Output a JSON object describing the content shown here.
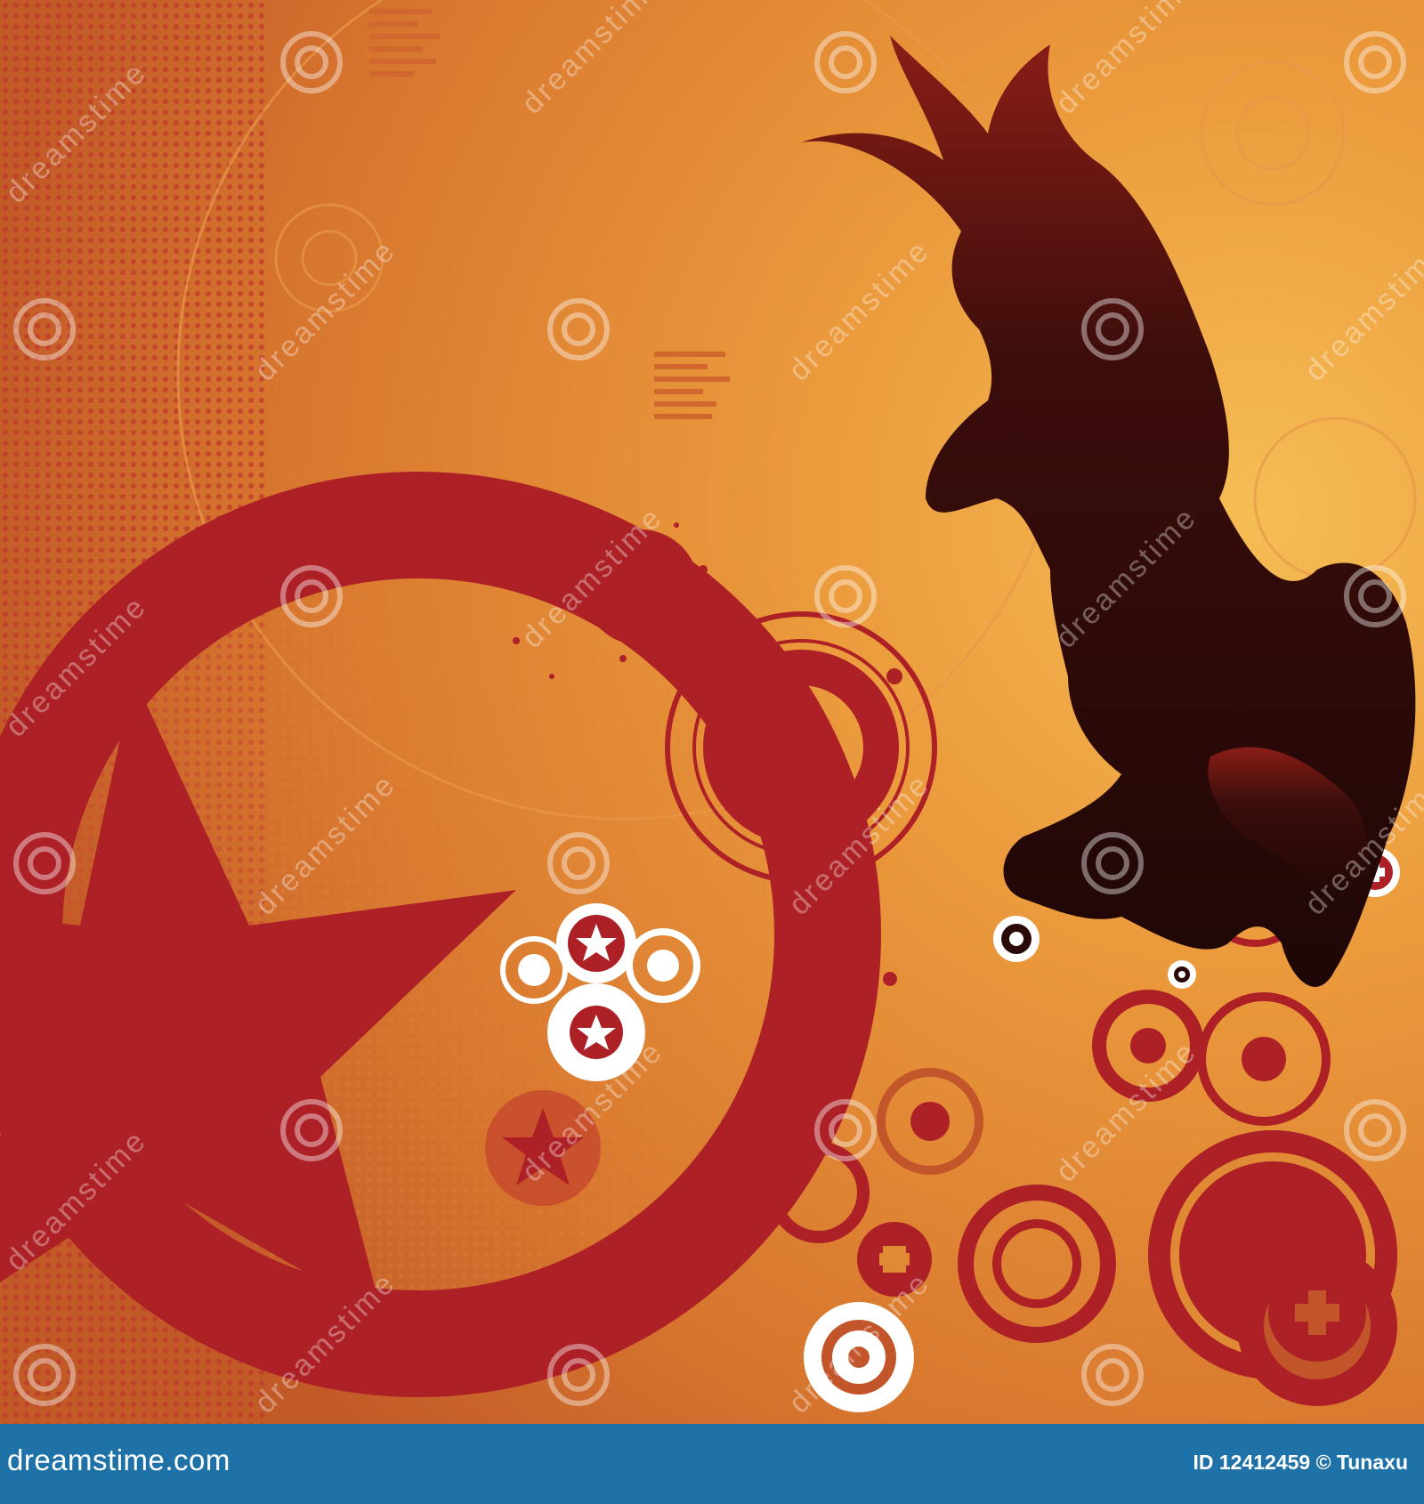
{
  "image": {
    "description_free_note": "",
    "palette": {
      "background_light": "#f2b04c",
      "background_mid": "#e08a35",
      "background_dark": "#c2552a",
      "red": "#ad2026",
      "dark_red": "#8a1a1e",
      "silhouette": "#2a0a08",
      "white": "#ffffff",
      "footer": "#1f72a8"
    },
    "icons": [
      "star-icon",
      "target-icon",
      "plus-icon",
      "spiral-watermark-icon"
    ]
  },
  "watermark": {
    "text": "dreamstime"
  },
  "footer": {
    "site_label": "dreamstime.com",
    "id_label": "ID 12412459 © Tunaxu"
  }
}
